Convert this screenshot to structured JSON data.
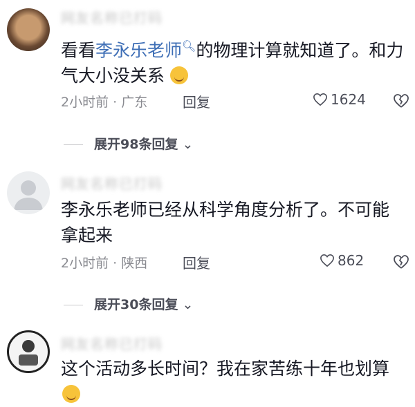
{
  "comments": [
    {
      "username": "网友名称已打码",
      "text_prefix": "看看",
      "mention": "李永乐老师",
      "text_suffix": "的物理计算就知道了。和力",
      "text_line2": "气大小没关系",
      "time_location": "2小时前 · 广东",
      "reply_label": "回复",
      "likes": "1624",
      "expand_label": "展开98条回复"
    },
    {
      "username": "网友名称已打码",
      "text_line1": "李永乐老师已经从科学角度分析了。不可能",
      "text_line2": "拿起来",
      "time_location": "2小时前 · 陕西",
      "reply_label": "回复",
      "likes": "862",
      "expand_label": "展开30条回复"
    },
    {
      "username": "网友名称已打码",
      "text_line1": "这个活动多长时间？我在家苦练十年也划算"
    }
  ]
}
